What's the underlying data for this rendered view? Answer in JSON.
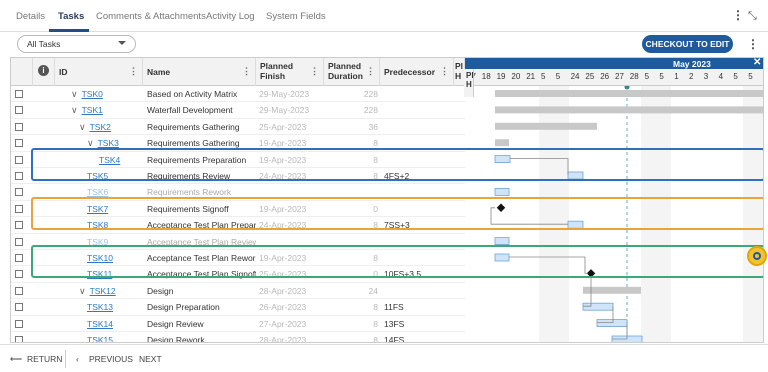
{
  "tabs": [
    "Details",
    "Tasks",
    "Comments & Attachments",
    "Activity Log",
    "System Fields"
  ],
  "filter": {
    "selected": "All Tasks"
  },
  "checkout_label": "CHECKOUT TO EDIT",
  "columns": {
    "id": "ID",
    "name": "Name",
    "finish_1": "Planned",
    "finish_2": "Finish",
    "duration_1": "Planned",
    "duration_2": "Duration",
    "predecessor": "Predecessor",
    "pl_1": "Pl",
    "pl_2": "H"
  },
  "gantt": {
    "month": "May 2023",
    "days": [
      "17",
      "18",
      "19",
      "20",
      "21",
      "5",
      "5",
      "24",
      "25",
      "26",
      "27",
      "28",
      "5",
      "5",
      "1",
      "2",
      "3",
      "4",
      "5",
      "5"
    ]
  },
  "rows": [
    {
      "id": "TSK0",
      "name": "Based on Activity Matrix",
      "finish": "29-May-2023",
      "duration": "228",
      "pred": "",
      "indent": 1,
      "expand": true,
      "faded": false
    },
    {
      "id": "TSK1",
      "name": "Waterfall Development",
      "finish": "29-May-2023",
      "duration": "228",
      "pred": "",
      "indent": 1,
      "expand": true,
      "faded": false
    },
    {
      "id": "TSK2",
      "name": "Requirements Gathering",
      "finish": "25-Apr-2023",
      "duration": "36",
      "pred": "",
      "indent": 2,
      "expand": true,
      "faded": false
    },
    {
      "id": "TSK3",
      "name": "Requirements Gathering",
      "finish": "19-Apr-2023",
      "duration": "8",
      "pred": "",
      "indent": 3,
      "expand": true,
      "faded": false
    },
    {
      "id": "TSK4",
      "name": "Requirements Preparation",
      "finish": "19-Apr-2023",
      "duration": "8",
      "pred": "",
      "indent": 4,
      "expand": false,
      "faded": false
    },
    {
      "id": "TSK5",
      "name": "Requirements Review",
      "finish": "24-Apr-2023",
      "duration": "8",
      "pred": "4FS+2",
      "indent": 3,
      "expand": false,
      "faded": false
    },
    {
      "id": "TSK6",
      "name": "Requirements Rework",
      "finish": "",
      "duration": "",
      "pred": "",
      "indent": 3,
      "expand": false,
      "faded": true
    },
    {
      "id": "TSK7",
      "name": "Requirements Signoff",
      "finish": "19-Apr-2023",
      "duration": "0",
      "pred": "",
      "indent": 3,
      "expand": false,
      "faded": false
    },
    {
      "id": "TSK8",
      "name": "Acceptance Test Plan Preparation",
      "finish": "24-Apr-2023",
      "duration": "8",
      "pred": "7SS+3",
      "indent": 3,
      "expand": false,
      "faded": false
    },
    {
      "id": "TSK9",
      "name": "Acceptance Test Plan Review",
      "finish": "",
      "duration": "",
      "pred": "",
      "indent": 3,
      "expand": false,
      "faded": true
    },
    {
      "id": "TSK10",
      "name": "Acceptance Test Plan Rework",
      "finish": "19-Apr-2023",
      "duration": "8",
      "pred": "",
      "indent": 3,
      "expand": false,
      "faded": false
    },
    {
      "id": "TSK11",
      "name": "Acceptance Test Plan Signoff",
      "finish": "25-Apr-2023",
      "duration": "0",
      "pred": "10FS+3.5",
      "indent": 3,
      "expand": false,
      "faded": false
    },
    {
      "id": "TSK12",
      "name": "Design",
      "finish": "28-Apr-2023",
      "duration": "24",
      "pred": "",
      "indent": 2,
      "expand": true,
      "faded": false
    },
    {
      "id": "TSK13",
      "name": "Design Preparation",
      "finish": "26-Apr-2023",
      "duration": "8",
      "pred": "11FS",
      "indent": 3,
      "expand": false,
      "faded": false
    },
    {
      "id": "TSK14",
      "name": "Design Review",
      "finish": "27-Apr-2023",
      "duration": "8",
      "pred": "13FS",
      "indent": 3,
      "expand": false,
      "faded": false
    },
    {
      "id": "TSK15",
      "name": "Design Rework",
      "finish": "28-Apr-2023",
      "duration": "8",
      "pred": "14FS",
      "indent": 3,
      "expand": false,
      "faded": false
    }
  ],
  "nav": {
    "return": "RETURN",
    "previous": "PREVIOUS",
    "next": "NEXT"
  },
  "colors": {
    "accent": "#1f5b9c",
    "highlight_blue": "#2e6fbf",
    "highlight_orange": "#e8a33a",
    "highlight_green": "#3aa877"
  }
}
